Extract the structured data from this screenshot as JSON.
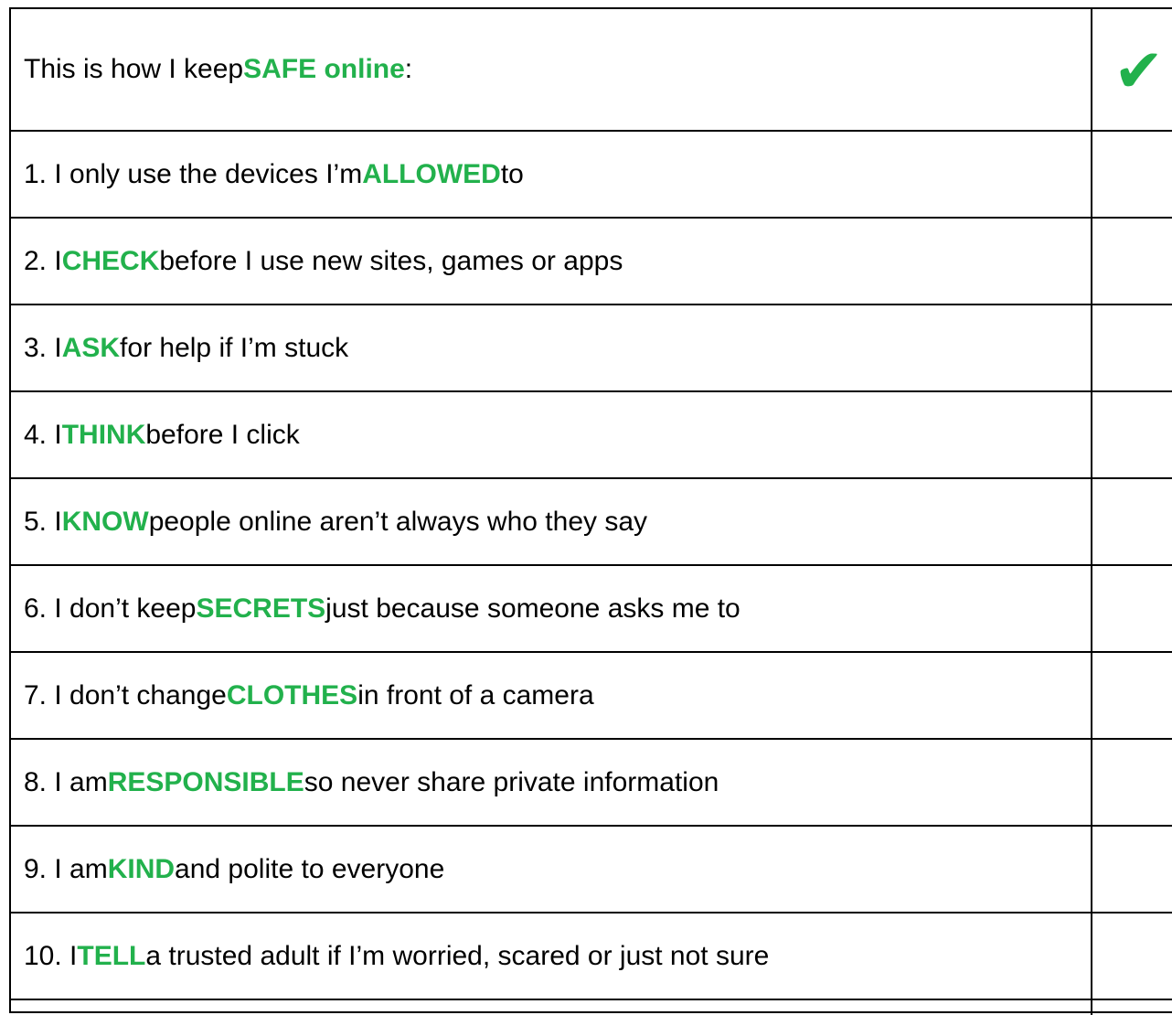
{
  "header": {
    "prefix": "This is how I keep ",
    "keyword": "SAFE online",
    "suffix": ":",
    "check_icon": "✔",
    "accent_color": "#22b14c"
  },
  "items": [
    {
      "prefix": "1. I only use the devices I’m ",
      "keyword": "ALLOWED",
      "suffix": " to"
    },
    {
      "prefix": "2. I ",
      "keyword": "CHECK",
      "suffix": " before I use new sites, games or apps"
    },
    {
      "prefix": "3. I ",
      "keyword": "ASK",
      "suffix": " for help if I’m stuck"
    },
    {
      "prefix": "4. I ",
      "keyword": "THINK",
      "suffix": " before I click"
    },
    {
      "prefix": "5. I ",
      "keyword": "KNOW",
      "suffix": " people online aren’t always who they say"
    },
    {
      "prefix": "6. I don’t keep ",
      "keyword": "SECRETS",
      "suffix": " just because someone asks me to"
    },
    {
      "prefix": "7. I don’t change ",
      "keyword": "CLOTHES",
      "suffix": " in front of a camera"
    },
    {
      "prefix": "8. I am ",
      "keyword": "RESPONSIBLE",
      "suffix": " so never share private information"
    },
    {
      "prefix": "9. I am ",
      "keyword": "KIND",
      "suffix": " and polite to everyone"
    },
    {
      "prefix": "10. I ",
      "keyword": "TELL",
      "suffix": " a trusted adult if I’m worried, scared or just not sure"
    }
  ]
}
